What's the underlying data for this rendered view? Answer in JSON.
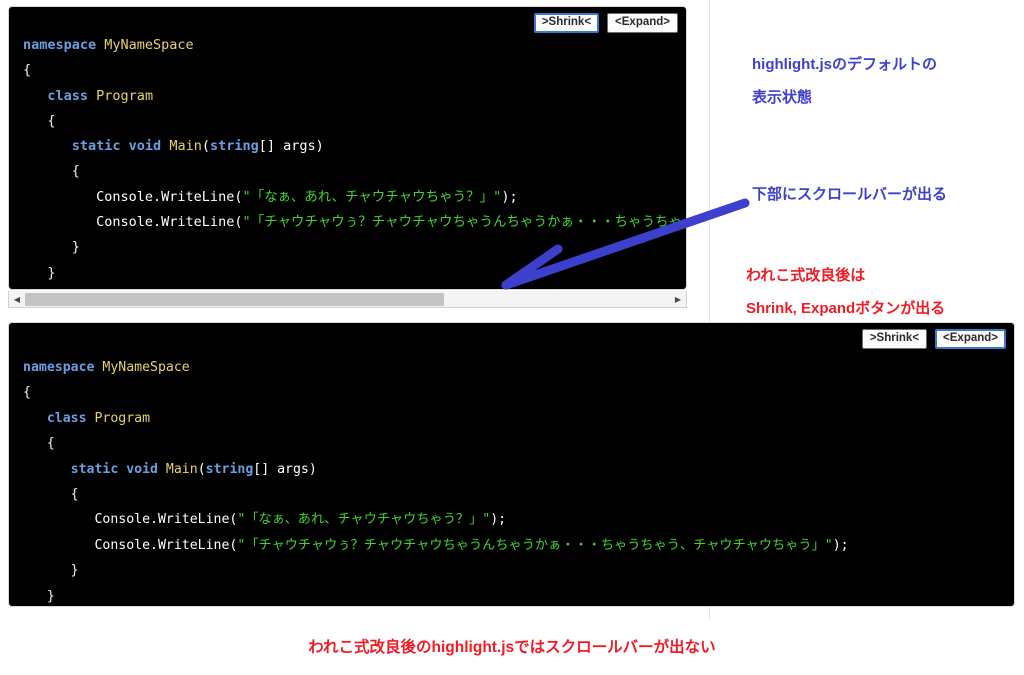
{
  "blocks": {
    "top": {
      "name": "default-highlight-js-code-block",
      "buttons": {
        "shrink": ">Shrink<",
        "expand": "<Expand>",
        "focused": "shrink"
      },
      "has_scrollbar": true,
      "code_lines": [
        [
          {
            "t": "namespace ",
            "c": "kw"
          },
          {
            "t": "MyNameSpace",
            "c": "typ"
          }
        ],
        [
          {
            "t": "{",
            "c": "brc"
          }
        ],
        [
          {
            "t": "   ",
            "c": "pln"
          },
          {
            "t": "class ",
            "c": "kw"
          },
          {
            "t": "Program",
            "c": "typ"
          }
        ],
        [
          {
            "t": "   ",
            "c": "pln"
          },
          {
            "t": "{",
            "c": "brc"
          }
        ],
        [
          {
            "t": "      ",
            "c": "pln"
          },
          {
            "t": "static void ",
            "c": "kw"
          },
          {
            "t": "Main",
            "c": "typ"
          },
          {
            "t": "(",
            "c": "pln"
          },
          {
            "t": "string",
            "c": "kw"
          },
          {
            "t": "[] args)",
            "c": "pln"
          }
        ],
        [
          {
            "t": "      ",
            "c": "pln"
          },
          {
            "t": "{",
            "c": "brc"
          }
        ],
        [
          {
            "t": "         Console.WriteLine(",
            "c": "pln"
          },
          {
            "t": "\"「なぁ、あれ、チャウチャウちゃう？」\"",
            "c": "str"
          },
          {
            "t": ");",
            "c": "pln"
          }
        ],
        [
          {
            "t": "         Console.WriteLine(",
            "c": "pln"
          },
          {
            "t": "\"「チャウチャウぅ？チャウチャウちゃうんちゃうかぁ・・・ちゃうちゃう、チャウチャウちゃう」\"",
            "c": "str"
          },
          {
            "t": ");",
            "c": "pln"
          }
        ],
        [
          {
            "t": "      ",
            "c": "pln"
          },
          {
            "t": "}",
            "c": "brc"
          }
        ],
        [
          {
            "t": "   ",
            "c": "pln"
          },
          {
            "t": "}",
            "c": "brc"
          }
        ],
        [
          {
            "t": "}",
            "c": "brc"
          }
        ]
      ],
      "scrollbar": {
        "left_arrow": "◀",
        "right_arrow": "▶",
        "thumb_percent": 65
      }
    },
    "bottom": {
      "name": "wareko-style-improved-code-block",
      "buttons": {
        "shrink": ">Shrink<",
        "expand": "<Expand>",
        "focused": "expand"
      },
      "has_scrollbar": false,
      "code_lines": [
        [
          {
            "t": "namespace ",
            "c": "kw"
          },
          {
            "t": "MyNameSpace",
            "c": "typ"
          }
        ],
        [
          {
            "t": "{",
            "c": "brc"
          }
        ],
        [
          {
            "t": "   ",
            "c": "pln"
          },
          {
            "t": "class ",
            "c": "kw"
          },
          {
            "t": "Program",
            "c": "typ"
          }
        ],
        [
          {
            "t": "   ",
            "c": "pln"
          },
          {
            "t": "{",
            "c": "brc"
          }
        ],
        [
          {
            "t": "      ",
            "c": "pln"
          },
          {
            "t": "static void ",
            "c": "kw"
          },
          {
            "t": "Main",
            "c": "typ"
          },
          {
            "t": "(",
            "c": "pln"
          },
          {
            "t": "string",
            "c": "kw"
          },
          {
            "t": "[] args)",
            "c": "pln"
          }
        ],
        [
          {
            "t": "      ",
            "c": "pln"
          },
          {
            "t": "{",
            "c": "brc"
          }
        ],
        [
          {
            "t": "         Console.WriteLine(",
            "c": "pln"
          },
          {
            "t": "\"「なぁ、あれ、チャウチャウちゃう？」\"",
            "c": "str"
          },
          {
            "t": ");",
            "c": "pln"
          }
        ],
        [
          {
            "t": "         Console.WriteLine(",
            "c": "pln"
          },
          {
            "t": "\"「チャウチャウぅ？チャウチャウちゃうんちゃうかぁ・・・ちゃうちゃう、チャウチャウちゃう」\"",
            "c": "str"
          },
          {
            "t": ");",
            "c": "pln"
          }
        ],
        [
          {
            "t": "      ",
            "c": "pln"
          },
          {
            "t": "}",
            "c": "brc"
          }
        ],
        [
          {
            "t": "   ",
            "c": "pln"
          },
          {
            "t": "}",
            "c": "brc"
          }
        ],
        [
          {
            "t": "}",
            "c": "brc"
          }
        ]
      ]
    }
  },
  "annotations": {
    "default_state": {
      "line1": "highlight.jsのデフォルトの",
      "line2": "表示状態",
      "color": "#3d40cc"
    },
    "scrollbar_note": {
      "line1": "下部にスクロールバーが出る",
      "color": "#3d40cc"
    },
    "wareko_note": {
      "line1": "われこ式改良後は",
      "line2": "Shrink, Expandボタンが出る",
      "color": "#f01b24"
    },
    "caption": {
      "text": "われこ式改良後のhighlight.jsではスクロールバーが出ない",
      "color": "#f01b24"
    },
    "arrow": {
      "color": "#3d40cc",
      "name": "blue-pointer-arrow"
    }
  },
  "colors": {
    "code_background": "#000000",
    "keyword": "#6a9fe0",
    "identifier": "#e8d36a",
    "string": "#3fd430",
    "plain": "#ffffff",
    "focus_border": "#3a78c8"
  }
}
